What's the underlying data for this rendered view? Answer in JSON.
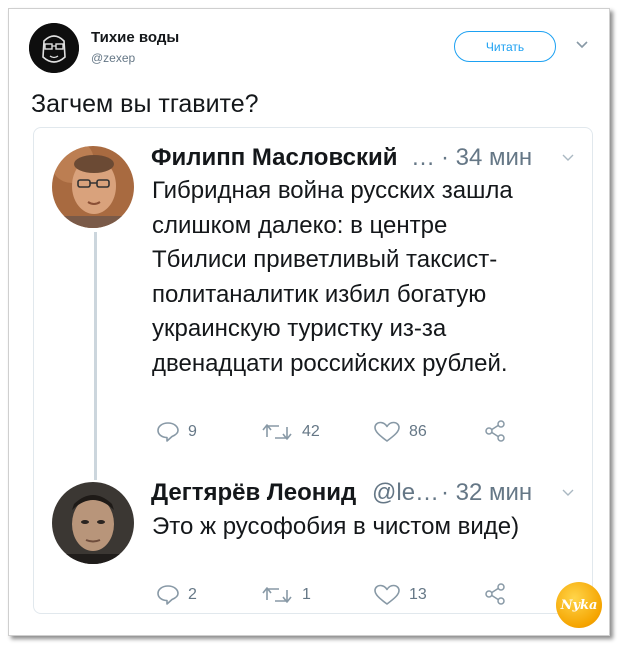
{
  "tweet": {
    "author_name": "Тихие воды",
    "author_handle": "@zexep",
    "follow_label": "Читать",
    "text": "Загчем вы тгавите?"
  },
  "replies": [
    {
      "name": "Филипп Масловский",
      "name_suffix": "…",
      "time": "· 34 мин",
      "lines": [
        "Гибридная война русских зашла",
        "слишком далеко: в центре",
        "Тбилиси приветливый таксист-",
        "политаналитик избил богатую",
        "украинскую туристку из-за",
        "двенадцати российских рублей."
      ],
      "replies_count": "9",
      "retweets_count": "42",
      "likes_count": "86"
    },
    {
      "name": "Дегтярёв Леонид",
      "name_suffix": "@le…",
      "time": "· 32 мин",
      "lines": [
        "Это ж русофобия в чистом виде)"
      ],
      "replies_count": "2",
      "retweets_count": "1",
      "likes_count": "13"
    }
  ],
  "watermark": {
    "text": "Nyka"
  },
  "colors": {
    "accent": "#1da1f2",
    "text": "#14171a",
    "muted": "#657786",
    "border": "#e1e8ed"
  },
  "icons": [
    "reply-icon",
    "retweet-icon",
    "like-icon",
    "share-icon",
    "chevron-down-icon"
  ]
}
